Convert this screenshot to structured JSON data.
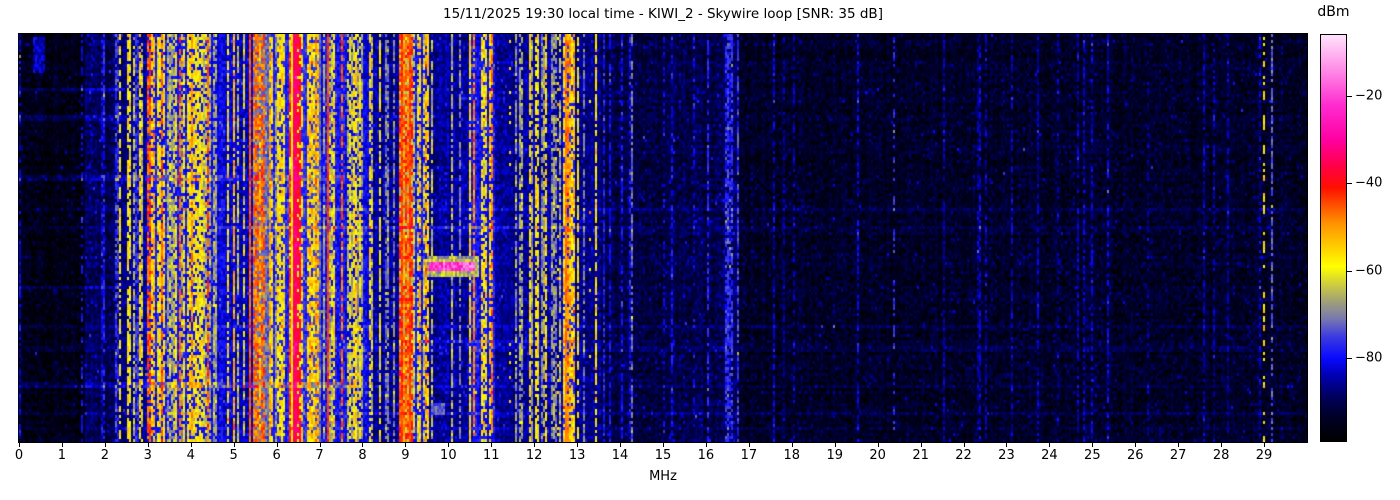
{
  "chart_data": {
    "type": "heatmap",
    "title": "15/11/2025 19:30 local time - KIWI_2 - Skywire loop [SNR: 35 dB]",
    "xlabel": "MHz",
    "x_range": [
      0,
      30
    ],
    "x_ticks": [
      0,
      1,
      2,
      3,
      4,
      5,
      6,
      7,
      8,
      9,
      10,
      11,
      12,
      13,
      14,
      15,
      16,
      17,
      18,
      19,
      20,
      21,
      22,
      23,
      24,
      25,
      26,
      27,
      28,
      29
    ],
    "y_ticks": [],
    "colorbar": {
      "label": "dBm",
      "vmin": -99,
      "vmax": -6,
      "ticks": [
        {
          "value": -20,
          "label": "−20"
        },
        {
          "value": -40,
          "label": "−40"
        },
        {
          "value": -60,
          "label": "−60"
        },
        {
          "value": -80,
          "label": "−80"
        }
      ],
      "stops": [
        [
          -99,
          "#000000"
        ],
        [
          -94,
          "#000022"
        ],
        [
          -89,
          "#00005a"
        ],
        [
          -84,
          "#0000b4"
        ],
        [
          -80,
          "#0a0aff"
        ],
        [
          -75,
          "#3c3ce0"
        ],
        [
          -71,
          "#7878b0"
        ],
        [
          -67,
          "#a0a078"
        ],
        [
          -63,
          "#cfcf3c"
        ],
        [
          -59,
          "#ffff00"
        ],
        [
          -54,
          "#ffc800"
        ],
        [
          -49,
          "#ff9000"
        ],
        [
          -45,
          "#ff5000"
        ],
        [
          -41,
          "#ff0f00"
        ],
        [
          -36,
          "#ff0048"
        ],
        [
          -30,
          "#ff00a0"
        ],
        [
          -22,
          "#ff2cd0"
        ],
        [
          -14,
          "#ff8ce6"
        ],
        [
          -6,
          "#ffe2fc"
        ]
      ]
    },
    "bands": [
      {
        "from": 0.0,
        "to": 1.55,
        "floor": -96,
        "density": 0.05,
        "stripes": [
          [
            -85,
            1
          ]
        ]
      },
      {
        "from": 1.55,
        "to": 2.28,
        "floor": -90,
        "density": 0.32,
        "stripes": [
          [
            -80,
            0.7
          ],
          [
            -74,
            0.3
          ]
        ]
      },
      {
        "from": 2.28,
        "to": 2.45,
        "floor": -88,
        "density": 0.25,
        "stripes": [
          [
            -78,
            0.6
          ],
          [
            -58,
            0.4
          ]
        ]
      },
      {
        "from": 2.45,
        "to": 3.0,
        "floor": -86,
        "density": 0.42,
        "stripes": [
          [
            -76,
            0.5
          ],
          [
            -66,
            0.3
          ],
          [
            -58,
            0.2
          ]
        ]
      },
      {
        "from": 3.0,
        "to": 4.55,
        "floor": -80,
        "density": 0.78,
        "stripes": [
          [
            -58,
            0.4
          ],
          [
            -52,
            0.22
          ],
          [
            -66,
            0.24
          ],
          [
            -46,
            0.14
          ]
        ]
      },
      {
        "from": 4.55,
        "to": 5.1,
        "floor": -82,
        "density": 0.55,
        "stripes": [
          [
            -60,
            0.45
          ],
          [
            -68,
            0.35
          ],
          [
            -52,
            0.2
          ]
        ]
      },
      {
        "from": 5.1,
        "to": 5.45,
        "floor": -83,
        "density": 0.3,
        "stripes": [
          [
            -64,
            0.6
          ],
          [
            -57,
            0.4
          ]
        ]
      },
      {
        "from": 5.45,
        "to": 5.85,
        "floor": -72,
        "density": 0.85,
        "stripes": [
          [
            -47,
            0.45
          ],
          [
            -52,
            0.3
          ],
          [
            -58,
            0.25
          ]
        ]
      },
      {
        "from": 5.85,
        "to": 6.28,
        "floor": -78,
        "density": 0.7,
        "stripes": [
          [
            -58,
            0.5
          ],
          [
            -52,
            0.3
          ],
          [
            -68,
            0.2
          ]
        ]
      },
      {
        "from": 6.28,
        "to": 6.55,
        "floor": -60,
        "density": 0.95,
        "stripes": [
          [
            -37,
            0.5
          ],
          [
            -43,
            0.5
          ]
        ]
      },
      {
        "from": 6.55,
        "to": 6.85,
        "floor": -77,
        "density": 0.7,
        "stripes": [
          [
            -55,
            0.5
          ],
          [
            -48,
            0.3
          ],
          [
            -68,
            0.2
          ]
        ]
      },
      {
        "from": 6.85,
        "to": 7.05,
        "floor": -74,
        "density": 0.8,
        "stripes": [
          [
            -52,
            0.6
          ],
          [
            -58,
            0.4
          ]
        ]
      },
      {
        "from": 7.05,
        "to": 7.6,
        "floor": -80,
        "density": 0.55,
        "stripes": [
          [
            -58,
            0.5
          ],
          [
            -66,
            0.3
          ],
          [
            -49,
            0.2
          ]
        ]
      },
      {
        "from": 7.6,
        "to": 8.25,
        "floor": -82,
        "density": 0.5,
        "stripes": [
          [
            -58,
            0.55
          ],
          [
            -67,
            0.45
          ]
        ]
      },
      {
        "from": 8.25,
        "to": 8.85,
        "floor": -86,
        "density": 0.25,
        "stripes": [
          [
            -70,
            0.6
          ],
          [
            -60,
            0.4
          ]
        ]
      },
      {
        "from": 8.85,
        "to": 9.2,
        "floor": -64,
        "density": 0.9,
        "stripes": [
          [
            -48,
            0.5
          ],
          [
            -43,
            0.3
          ],
          [
            -55,
            0.2
          ]
        ]
      },
      {
        "from": 9.2,
        "to": 9.5,
        "floor": -80,
        "density": 0.5,
        "stripes": [
          [
            -54,
            0.5
          ],
          [
            -63,
            0.5
          ]
        ]
      },
      {
        "from": 9.5,
        "to": 10.5,
        "floor": -86,
        "density": 0.18,
        "stripes": [
          [
            -67,
            0.6
          ],
          [
            -58,
            0.4
          ]
        ]
      },
      {
        "from": 10.5,
        "to": 11.1,
        "floor": -80,
        "density": 0.6,
        "stripes": [
          [
            -56,
            0.5
          ],
          [
            -63,
            0.3
          ],
          [
            -50,
            0.2
          ]
        ]
      },
      {
        "from": 11.1,
        "to": 12.65,
        "floor": -86,
        "density": 0.22,
        "stripes": [
          [
            -68,
            0.6
          ],
          [
            -58,
            0.4
          ]
        ]
      },
      {
        "from": 12.65,
        "to": 12.95,
        "floor": -78,
        "density": 0.8,
        "stripes": [
          [
            -55,
            0.5
          ],
          [
            -48,
            0.5
          ]
        ]
      },
      {
        "from": 12.95,
        "to": 13.55,
        "floor": -87,
        "density": 0.2,
        "stripes": [
          [
            -70,
            0.6
          ],
          [
            -60,
            0.4
          ]
        ]
      },
      {
        "from": 13.55,
        "to": 16.4,
        "floor": -91,
        "density": 0.1,
        "stripes": [
          [
            -80,
            0.8
          ],
          [
            -73,
            0.2
          ]
        ]
      },
      {
        "from": 16.4,
        "to": 16.75,
        "floor": -89,
        "density": 0.5,
        "stripes": [
          [
            -77,
            1
          ]
        ]
      },
      {
        "from": 16.75,
        "to": 30.0,
        "floor": -94,
        "density": 0.05,
        "stripes": [
          [
            -85,
            1
          ]
        ]
      }
    ],
    "lines": [
      {
        "f": 1.45,
        "level": -81,
        "w": 0.02,
        "duty": 0.4
      },
      {
        "f": 2.33,
        "level": -58,
        "w": 0.04,
        "duty": 0.55
      },
      {
        "f": 5.4,
        "level": -46,
        "w": 0.04,
        "duty": 1
      },
      {
        "f": 6.4,
        "level": -34,
        "w": 0.08,
        "duty": 1
      },
      {
        "f": 7.21,
        "level": -44,
        "w": 0.05,
        "duty": 1
      },
      {
        "f": 8.93,
        "level": -44,
        "w": 0.04,
        "duty": 1
      },
      {
        "f": 9.13,
        "level": -44,
        "w": 0.05,
        "duty": 1
      },
      {
        "f": 10.25,
        "level": -70,
        "w": 0.03,
        "duty": 0.7
      },
      {
        "f": 11.45,
        "level": -56,
        "w": 0.04,
        "duty": 0.1
      },
      {
        "f": 12.03,
        "level": -58,
        "w": 0.04,
        "duty": 0.75
      },
      {
        "f": 12.55,
        "level": -56,
        "w": 0.04,
        "duty": 0.1
      },
      {
        "f": 12.74,
        "level": -48,
        "w": 0.06,
        "duty": 1
      },
      {
        "f": 13.3,
        "level": -56,
        "w": 0.04,
        "duty": 0.08
      },
      {
        "f": 13.77,
        "level": -80,
        "w": 0.03,
        "duty": 0.6
      },
      {
        "f": 14.06,
        "level": -80,
        "w": 0.03,
        "duty": 0.6
      },
      {
        "f": 15.0,
        "level": -81,
        "w": 0.03,
        "duty": 0.4
      },
      {
        "f": 15.7,
        "level": -82,
        "w": 0.03,
        "duty": 0.5
      },
      {
        "f": 16.05,
        "level": -78,
        "w": 0.03,
        "duty": 0.6
      },
      {
        "f": 16.5,
        "level": -76,
        "w": 0.04,
        "duty": 0.7
      },
      {
        "f": 16.63,
        "level": -76,
        "w": 0.04,
        "duty": 0.7
      },
      {
        "f": 18.05,
        "level": -84,
        "w": 0.03,
        "duty": 0.5
      },
      {
        "f": 20.4,
        "level": -77,
        "w": 0.03,
        "duty": 0.45
      },
      {
        "f": 22.5,
        "level": -85,
        "w": 0.03,
        "duty": 0.6
      },
      {
        "f": 24.2,
        "level": -86,
        "w": 0.03,
        "duty": 0.5
      },
      {
        "f": 26.3,
        "level": -86,
        "w": 0.03,
        "duty": 0.4
      },
      {
        "f": 29.0,
        "level": -57,
        "w": 0.04,
        "duty": 0.4
      },
      {
        "f": 29.19,
        "level": -73,
        "w": 0.04,
        "duty": 0.6
      }
    ],
    "transients": [
      {
        "f0": 9.5,
        "f1": 10.7,
        "y0": 0.545,
        "y1": 0.592,
        "level": -66,
        "var": 6
      },
      {
        "f0": 9.55,
        "f1": 10.6,
        "y0": 0.557,
        "y1": 0.578,
        "level": -20,
        "var": 9
      },
      {
        "f0": 0.33,
        "f1": 0.62,
        "y0": 0.005,
        "y1": 0.095,
        "level": -84,
        "var": 5
      },
      {
        "f0": 9.6,
        "f1": 9.9,
        "y0": 0.905,
        "y1": 0.935,
        "level": -73,
        "var": 4
      }
    ],
    "row_streaks": [
      {
        "y": 0.135,
        "f0": 0,
        "f1": 2.45,
        "boost": 6
      },
      {
        "y": 0.205,
        "f0": 0,
        "f1": 2.45,
        "boost": 5
      },
      {
        "y": 0.355,
        "f0": 0,
        "f1": 7.9,
        "boost": 5
      },
      {
        "y": 0.475,
        "f0": 4.6,
        "f1": 13.2,
        "boost": 4
      },
      {
        "y": 0.62,
        "f0": 0,
        "f1": 2.45,
        "boost": 5
      },
      {
        "y": 0.755,
        "f0": 8.8,
        "f1": 13.2,
        "boost": 4
      },
      {
        "y": 0.862,
        "f0": 0,
        "f1": 7.9,
        "boost": 5
      }
    ]
  }
}
